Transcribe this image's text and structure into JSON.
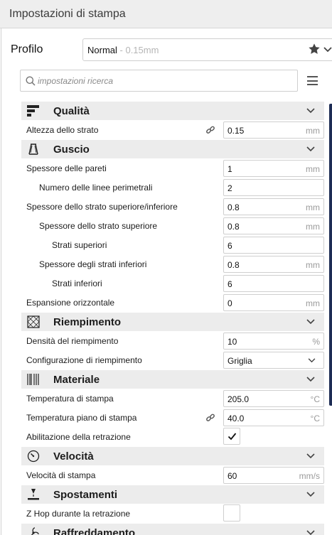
{
  "title": "Impostazioni di stampa",
  "profile": {
    "label": "Profilo",
    "name": "Normal",
    "sub": " - 0.15mm"
  },
  "search": {
    "placeholder": "impostazioni ricerca"
  },
  "colors": {
    "accent_scrollbar": "#1e2d55",
    "category_bg": "#ececec",
    "border": "#cfcfcf"
  },
  "sections": {
    "quality": {
      "label": "Qualità",
      "icon": "quality-icon",
      "layer_height": {
        "label": "Altezza dello strato",
        "value": "0.15",
        "unit": "mm"
      }
    },
    "shell": {
      "label": "Guscio",
      "icon": "shell-icon",
      "wall_thickness": {
        "label": "Spessore delle pareti",
        "value": "1",
        "unit": "mm"
      },
      "wall_line_count": {
        "label": "Numero delle linee perimetrali",
        "value": "2"
      },
      "top_bottom_thickness": {
        "label": "Spessore dello strato superiore/inferiore",
        "value": "0.8",
        "unit": "mm"
      },
      "top_thickness": {
        "label": "Spessore dello strato superiore",
        "value": "0.8",
        "unit": "mm"
      },
      "top_layers": {
        "label": "Strati superiori",
        "value": "6"
      },
      "bottom_thickness": {
        "label": "Spessore degli strati inferiori",
        "value": "0.8",
        "unit": "mm"
      },
      "bottom_layers": {
        "label": "Strati inferiori",
        "value": "6"
      },
      "horizontal_expansion": {
        "label": "Espansione orizzontale",
        "value": "0",
        "unit": "mm"
      }
    },
    "infill": {
      "label": "Riempimento",
      "icon": "infill-icon",
      "density": {
        "label": "Densità del riempimento",
        "value": "10",
        "unit": "%"
      },
      "pattern": {
        "label": "Configurazione di riempimento",
        "value": "Griglia"
      }
    },
    "material": {
      "label": "Materiale",
      "icon": "material-icon",
      "print_temp": {
        "label": "Temperatura di stampa",
        "value": "205.0",
        "unit": "°C"
      },
      "bed_temp": {
        "label": "Temperatura piano di stampa",
        "value": "40.0",
        "unit": "°C"
      },
      "retraction": {
        "label": "Abilitazione della retrazione",
        "checked": true
      }
    },
    "speed": {
      "label": "Velocità",
      "icon": "speed-icon",
      "print_speed": {
        "label": "Velocità di stampa",
        "value": "60",
        "unit": "mm/s"
      }
    },
    "travel": {
      "label": "Spostamenti",
      "icon": "travel-icon",
      "z_hop": {
        "label": "Z Hop durante la retrazione",
        "checked": false
      }
    },
    "cooling": {
      "label": "Raffreddamento",
      "icon": "cooling-icon"
    }
  }
}
